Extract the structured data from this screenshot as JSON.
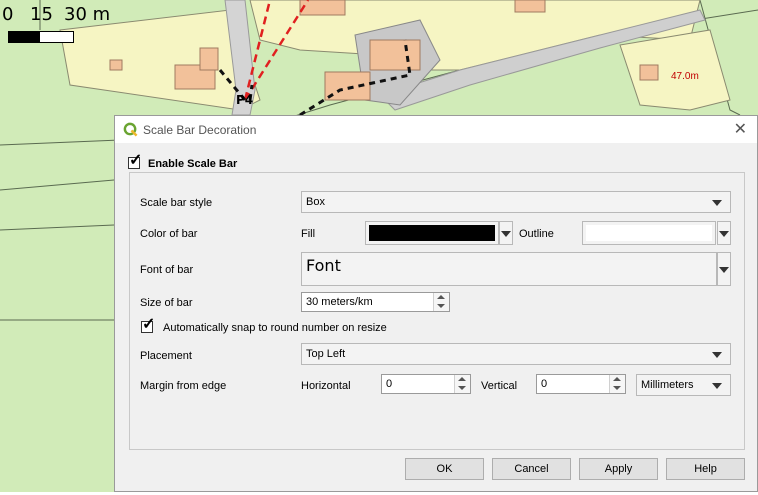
{
  "map": {
    "scale_ticks": [
      "0",
      "15",
      "30 m"
    ],
    "elevation_label": "47.0m"
  },
  "dialog": {
    "title": "Scale Bar Decoration",
    "close_icon": "close-icon",
    "enable_label": "Enable Scale Bar",
    "enable_checked": true,
    "style_label": "Scale bar style",
    "style_value": "Box",
    "color_label": "Color of bar",
    "fill_label": "Fill",
    "fill_color": "#000000",
    "outline_label": "Outline",
    "outline_color": "#ffffff",
    "font_label": "Font of bar",
    "font_button_label": "Font",
    "size_label": "Size of bar",
    "size_value": "30 meters/km",
    "snap_label": "Automatically snap to round number on resize",
    "snap_checked": true,
    "placement_label": "Placement",
    "placement_value": "Top Left",
    "margin_label": "Margin from edge",
    "horizontal_label": "Horizontal",
    "horizontal_value": "0",
    "vertical_label": "Vertical",
    "vertical_value": "0",
    "units_value": "Millimeters",
    "buttons": {
      "ok": "OK",
      "cancel": "Cancel",
      "apply": "Apply",
      "help": "Help"
    }
  }
}
